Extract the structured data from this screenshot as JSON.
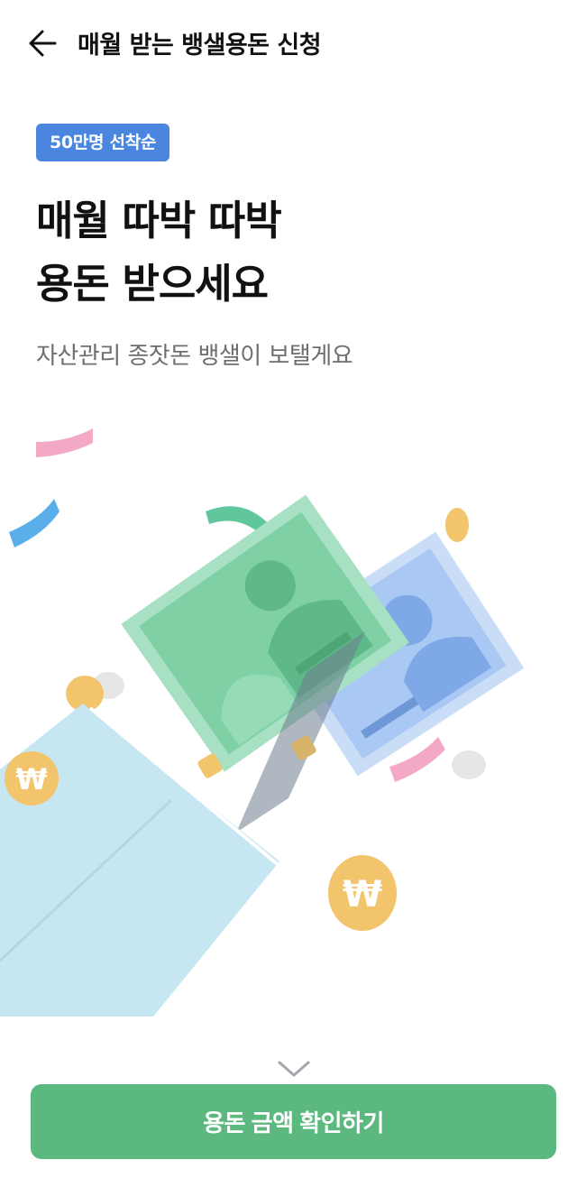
{
  "header": {
    "back_icon": "arrow-left-icon",
    "title": "매월 받는 뱅샐용돈 신청"
  },
  "badge": {
    "label": "50만명 선착순",
    "color": "#4a86df"
  },
  "hero": {
    "title_line1": "매월 따박 따박",
    "title_line2": "용돈 받으세요",
    "subtitle": "자산관리 종잣돈 뱅샐이 보탤게요"
  },
  "illustration": {
    "description_icon": "money-envelope-illustration",
    "coin_symbol_1": "₩",
    "coin_symbol_2": "₩"
  },
  "scroll_hint": {
    "icon": "chevron-down-icon"
  },
  "cta": {
    "label": "용돈 금액 확인하기",
    "color": "#5bb97f"
  }
}
